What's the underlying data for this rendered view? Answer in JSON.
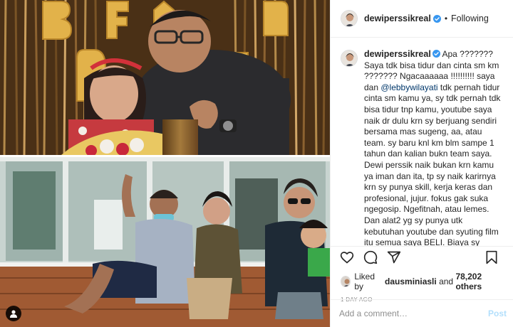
{
  "post": {
    "author": "dewiperssikreal",
    "follow_state": "Following",
    "header_separator": "•",
    "caption_text": "Apa ??????? Saya tdk bisa tidur dan cinta sm km ??????? Ngacaaaaaa !!!!!!!!!! saya dan ",
    "caption_mention": "@lebbywilayati",
    "caption_text_rest": " tdk pernah tidur cinta sm kamu ya, sy tdk pernah tdk bisa tidur tnp kamu, youtube saya naik dr dulu krn sy berjuang sendiri bersama mas sugeng, aa, atau team. sy baru knl km blm sampe 1 tahun dan kalian bukn team saya. Dewi perssik naik bukan krn kamu ya iman dan ita, tp sy naik karirnya krn sy punya skill, kerja keras dan profesional, jujur. fokus gak suka ngegosip. Ngefitnah, atau lemes. Dan alat2 yg sy punya utk kebutuhan youtube dan syuting film itu semua saya BELI. Biaya sy sendiri Tidak pinjam KEKAMU !!!!!! Justru",
    "liked_by_prefix": "Liked by",
    "liked_by_user": "dausminiasli",
    "liked_by_joiner": "and",
    "likes_count": "78,202 others",
    "timestamp": "1 DAY AGO",
    "comment_placeholder": "Add a comment…",
    "post_button": "Post"
  },
  "icons": {
    "like": "heart-icon",
    "comment": "comment-bubble-icon",
    "share": "paper-plane-icon",
    "save": "bookmark-icon",
    "tag": "user-tag-icon",
    "verified": "verified-badge-icon"
  },
  "colors": {
    "verified": "#3897f0",
    "mention": "#00376b",
    "post_button_disabled": "#b2dffc",
    "muted_text": "#8e8e8e",
    "divider": "#efefef"
  }
}
